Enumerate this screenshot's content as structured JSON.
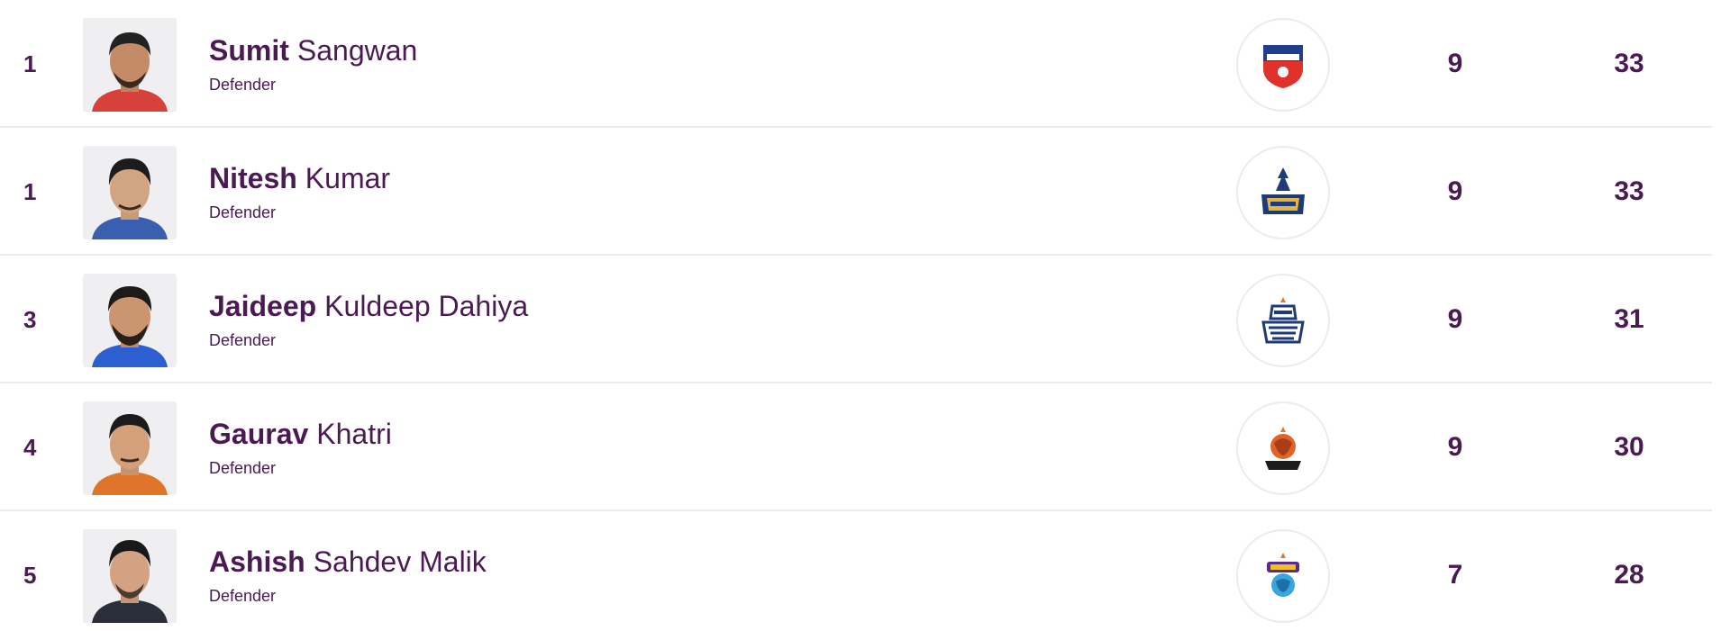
{
  "leaderboard": {
    "rows": [
      {
        "rank": "1",
        "first_name": "Sumit",
        "last_name": "Sangwan",
        "position": "Defender",
        "team_logo": "giants-logo-icon",
        "matches": "9",
        "points": "33",
        "jersey": "#d8403a"
      },
      {
        "rank": "1",
        "first_name": "Nitesh",
        "last_name": "Kumar",
        "position": "Defender",
        "team_logo": "thalaivas-logo-icon",
        "matches": "9",
        "points": "33",
        "jersey": "#3b5fb0"
      },
      {
        "rank": "3",
        "first_name": "Jaideep",
        "last_name": "Kuldeep Dahiya",
        "position": "Defender",
        "team_logo": "steelers-logo-icon",
        "matches": "9",
        "points": "31",
        "jersey": "#2c5fd0"
      },
      {
        "rank": "4",
        "first_name": "Gaurav",
        "last_name": "Khatri",
        "position": "Defender",
        "team_logo": "paltan-logo-icon",
        "matches": "9",
        "points": "30",
        "jersey": "#e0752a"
      },
      {
        "rank": "5",
        "first_name": "Ashish",
        "last_name": "Sahdev Malik",
        "position": "Defender",
        "team_logo": "bulls-logo-icon",
        "matches": "7",
        "points": "28",
        "jersey": "#2a2f3a"
      }
    ]
  },
  "colors": {
    "text": "#4a1a52",
    "divider": "#ececef",
    "photo_bg": "#efeff2"
  }
}
